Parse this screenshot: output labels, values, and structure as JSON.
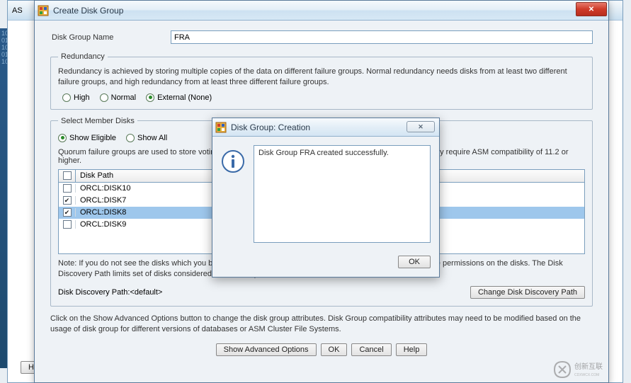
{
  "outer": {
    "title_prefix": "AS"
  },
  "window": {
    "title": "Create Disk Group"
  },
  "form": {
    "name_label": "Disk Group Name",
    "name_value": "FRA"
  },
  "redundancy": {
    "legend": "Redundancy",
    "description": "Redundancy is achieved by storing multiple copies of the data on different failure groups. Normal redundancy needs disks from at least two different failure groups, and high redundancy from at least three different failure groups.",
    "options": {
      "high": "High",
      "normal": "Normal",
      "external": "External (None)"
    }
  },
  "member": {
    "legend": "Select Member Disks",
    "show_eligible": "Show Eligible",
    "show_all": "Show All",
    "quorum_text": "Quorum failure groups are used to store voting files in extended clusters and do not contain any user data. They require ASM compatibility of 11.2 or higher.",
    "columns": {
      "disk_path": "Disk Path"
    },
    "rows": [
      {
        "path": "ORCL:DISK10",
        "checked": false,
        "selected": false
      },
      {
        "path": "ORCL:DISK7",
        "checked": true,
        "selected": false
      },
      {
        "path": "ORCL:DISK8",
        "checked": true,
        "selected": true
      },
      {
        "path": "ORCL:DISK9",
        "checked": false,
        "selected": false
      }
    ],
    "note": "Note: If you do not see the disks which you believe are available, check the Disk Discovery Path and read/write permissions on the disks. The Disk Discovery Path limits set of disks considered for discovery.",
    "discovery_label": "Disk Discovery Path:",
    "discovery_value": "<default>",
    "change_path_btn": "Change Disk Discovery Path"
  },
  "summary": "Click on the Show Advanced Options button to change the disk group attributes. Disk Group compatibility attributes may need to be modified based on the usage of disk group for different versions of databases or ASM Cluster File Systems.",
  "buttons": {
    "advanced": "Show Advanced Options",
    "ok": "OK",
    "cancel": "Cancel",
    "help": "Help"
  },
  "modal": {
    "title": "Disk Group: Creation",
    "message": "Disk Group FRA created successfully.",
    "ok": "OK"
  },
  "left_help": "Help",
  "watermark": "创新互联"
}
